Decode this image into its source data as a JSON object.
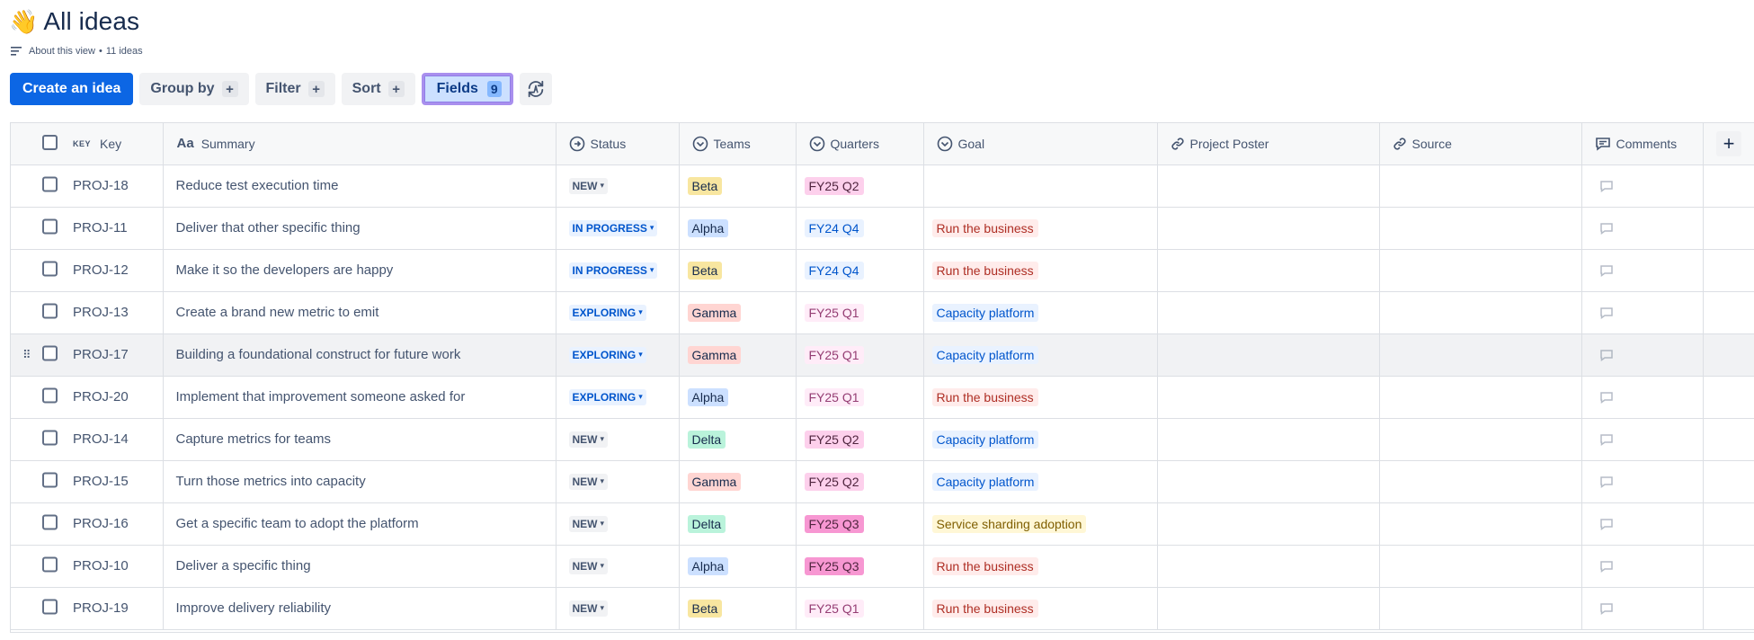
{
  "header": {
    "emoji": "👋",
    "title": "All ideas",
    "about_label": "About this view",
    "ideas_count": "11 ideas"
  },
  "toolbar": {
    "create_label": "Create an idea",
    "group_by_label": "Group by",
    "filter_label": "Filter",
    "sort_label": "Sort",
    "fields_label": "Fields",
    "fields_count": "9",
    "plus": "+"
  },
  "table": {
    "columns": {
      "key_small": "KEY",
      "key": "Key",
      "summary_aa": "Aa",
      "summary": "Summary",
      "status": "Status",
      "teams": "Teams",
      "quarters": "Quarters",
      "goal": "Goal",
      "project_poster": "Project Poster",
      "source": "Source",
      "comments": "Comments",
      "add": "+"
    },
    "rows": [
      {
        "key": "PROJ-18",
        "summary": "Reduce test execution time",
        "status": "NEW",
        "status_type": "new",
        "team": "Beta",
        "team_color": "#f8e6a0",
        "quarter": "FY25 Q2",
        "quarter_bg": "#fdd0ec",
        "quarter_fg": "#50253f",
        "goal": "",
        "goal_type": ""
      },
      {
        "key": "PROJ-11",
        "summary": "Deliver that other specific thing",
        "status": "IN PROGRESS",
        "status_type": "inprogress",
        "team": "Alpha",
        "team_color": "#cce0ff",
        "quarter": "FY24 Q4",
        "quarter_bg": "#e9f2ff",
        "quarter_fg": "#0055cc",
        "goal": "Run the business",
        "goal_type": "run"
      },
      {
        "key": "PROJ-12",
        "summary": "Make it so the developers are happy",
        "status": "IN PROGRESS",
        "status_type": "inprogress",
        "team": "Beta",
        "team_color": "#f8e6a0",
        "quarter": "FY24 Q4",
        "quarter_bg": "#e9f2ff",
        "quarter_fg": "#0055cc",
        "goal": "Run the business",
        "goal_type": "run"
      },
      {
        "key": "PROJ-13",
        "summary": "Create a brand new metric to emit",
        "status": "EXPLORING",
        "status_type": "exploring",
        "team": "Gamma",
        "team_color": "#ffd5d2",
        "quarter": "FY25 Q1",
        "quarter_bg": "#ffecf8",
        "quarter_fg": "#943d73",
        "goal": "Capacity platform",
        "goal_type": "capacity"
      },
      {
        "key": "PROJ-17",
        "summary": "Building a foundational construct for future work",
        "status": "EXPLORING",
        "status_type": "exploring",
        "team": "Gamma",
        "team_color": "#ffd5d2",
        "quarter": "FY25 Q1",
        "quarter_bg": "#ffecf8",
        "quarter_fg": "#943d73",
        "goal": "Capacity platform",
        "goal_type": "capacity",
        "hover": true
      },
      {
        "key": "PROJ-20",
        "summary": "Implement that improvement someone asked for",
        "status": "EXPLORING",
        "status_type": "exploring",
        "team": "Alpha",
        "team_color": "#cce0ff",
        "quarter": "FY25 Q1",
        "quarter_bg": "#ffecf8",
        "quarter_fg": "#943d73",
        "goal": "Run the business",
        "goal_type": "run"
      },
      {
        "key": "PROJ-14",
        "summary": "Capture metrics for teams",
        "status": "NEW",
        "status_type": "new",
        "team": "Delta",
        "team_color": "#baf3db",
        "quarter": "FY25 Q2",
        "quarter_bg": "#fdd0ec",
        "quarter_fg": "#50253f",
        "goal": "Capacity platform",
        "goal_type": "capacity"
      },
      {
        "key": "PROJ-15",
        "summary": "Turn those metrics into capacity",
        "status": "NEW",
        "status_type": "new",
        "team": "Gamma",
        "team_color": "#ffd5d2",
        "quarter": "FY25 Q2",
        "quarter_bg": "#fdd0ec",
        "quarter_fg": "#50253f",
        "goal": "Capacity platform",
        "goal_type": "capacity"
      },
      {
        "key": "PROJ-16",
        "summary": "Get a specific team to adopt the platform",
        "status": "NEW",
        "status_type": "new",
        "team": "Delta",
        "team_color": "#baf3db",
        "quarter": "FY25 Q3",
        "quarter_bg": "#f797d2",
        "quarter_fg": "#50253f",
        "goal": "Service sharding adoption",
        "goal_type": "sharding"
      },
      {
        "key": "PROJ-10",
        "summary": "Deliver a specific thing",
        "status": "NEW",
        "status_type": "new",
        "team": "Alpha",
        "team_color": "#cce0ff",
        "quarter": "FY25 Q3",
        "quarter_bg": "#f797d2",
        "quarter_fg": "#50253f",
        "goal": "Run the business",
        "goal_type": "run"
      },
      {
        "key": "PROJ-19",
        "summary": "Improve delivery reliability",
        "status": "NEW",
        "status_type": "new",
        "team": "Beta",
        "team_color": "#f8e6a0",
        "quarter": "FY25 Q1",
        "quarter_bg": "#ffecf8",
        "quarter_fg": "#943d73",
        "goal": "Run the business",
        "goal_type": "run"
      }
    ]
  },
  "colors": {
    "primary": "#0c66e4",
    "goal_run_bg": "#ffeceb",
    "goal_run_fg": "#ae2e24",
    "goal_capacity_bg": "#e9f2ff",
    "goal_capacity_fg": "#0055cc",
    "goal_sharding_bg": "#fff7d6",
    "goal_sharding_fg": "#7f5f01"
  }
}
